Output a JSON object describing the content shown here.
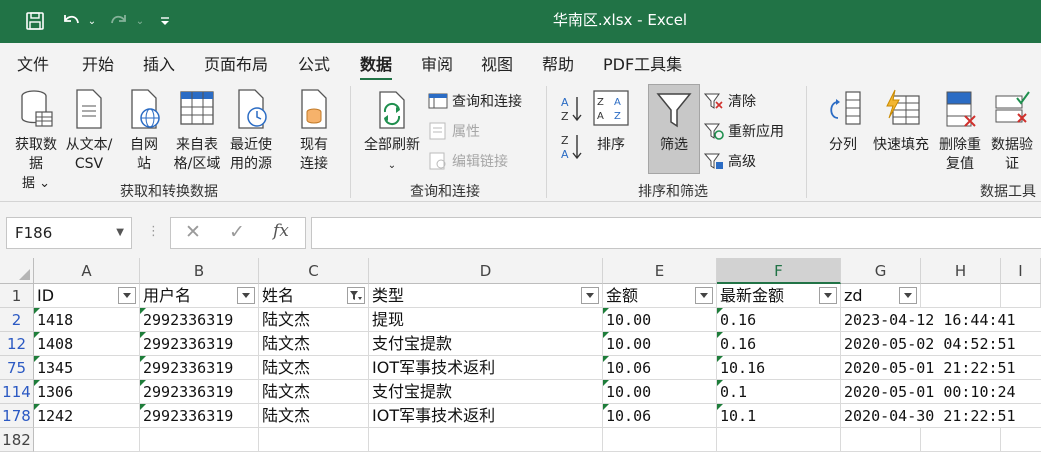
{
  "window": {
    "title": "华南区.xlsx  -  Excel"
  },
  "colors": {
    "accent": "#217346",
    "filtered_row_number": "#2b59c3",
    "error_marker": "#1e7d3a"
  },
  "quick_access": {
    "save_icon": "save-icon",
    "undo_icon": "undo-icon",
    "redo_icon": "redo-icon"
  },
  "menu": {
    "tabs": [
      "文件",
      "开始",
      "插入",
      "页面布局",
      "公式",
      "数据",
      "审阅",
      "视图",
      "帮助",
      "PDF工具集"
    ],
    "active": "数据"
  },
  "ribbon": {
    "get_data": "获取数据",
    "from_text_csv": "从文本/CSV",
    "from_web": "自网站",
    "from_table_range": "来自表格/区域",
    "recent_sources": "最近使用的源",
    "existing_connections": "现有连接",
    "group_get_transform": "获取和转换数据",
    "refresh_all": "全部刷新",
    "queries_connections": "查询和连接",
    "properties": "属性",
    "edit_links": "编辑链接",
    "group_queries": "查询和连接",
    "sort_az": "A→Z",
    "sort_za": "Z→A",
    "sort": "排序",
    "filter": "筛选",
    "clear": "清除",
    "reapply": "重新应用",
    "advanced": "高级",
    "group_sort_filter": "排序和筛选",
    "text_to_columns": "分列",
    "flash_fill": "快速填充",
    "remove_duplicates": "删除重复值",
    "data_validation": "数据验证",
    "group_data_tools": "数据工具"
  },
  "formula_bar": {
    "name_box": "F186",
    "cancel": "✕",
    "confirm": "✓",
    "fx": "fx",
    "content": ""
  },
  "grid": {
    "columns": [
      "A",
      "B",
      "C",
      "D",
      "E",
      "F",
      "G",
      "H",
      "I"
    ],
    "selected_column": "F",
    "header_row_number": "1",
    "headers": [
      "ID",
      "用户名",
      "姓名",
      "类型",
      "金额",
      "最新金额",
      "zd"
    ],
    "rows": [
      {
        "num": "2",
        "id": "1418",
        "user": "2992336319",
        "name": "陆文杰",
        "type": "提现",
        "amount": "10.00",
        "latest": "0.16",
        "zd": "2023-04-12  16:44:41"
      },
      {
        "num": "12",
        "id": "1408",
        "user": "2992336319",
        "name": "陆文杰",
        "type": "支付宝提款",
        "amount": "10.00",
        "latest": "0.16",
        "zd": "2020-05-02  04:52:51"
      },
      {
        "num": "75",
        "id": "1345",
        "user": "2992336319",
        "name": "陆文杰",
        "type": "IOT军事技术返利",
        "amount": "10.06",
        "latest": "10.16",
        "zd": "2020-05-01  21:22:51"
      },
      {
        "num": "114",
        "id": "1306",
        "user": "2992336319",
        "name": "陆文杰",
        "type": "支付宝提款",
        "amount": "10.00",
        "latest": "0.1",
        "zd": "2020-05-01  00:10:24"
      },
      {
        "num": "178",
        "id": "1242",
        "user": "2992336319",
        "name": "陆文杰",
        "type": "IOT军事技术返利",
        "amount": "10.06",
        "latest": "10.1",
        "zd": "2020-04-30  21:22:51"
      }
    ],
    "empty_row_number": "182"
  }
}
